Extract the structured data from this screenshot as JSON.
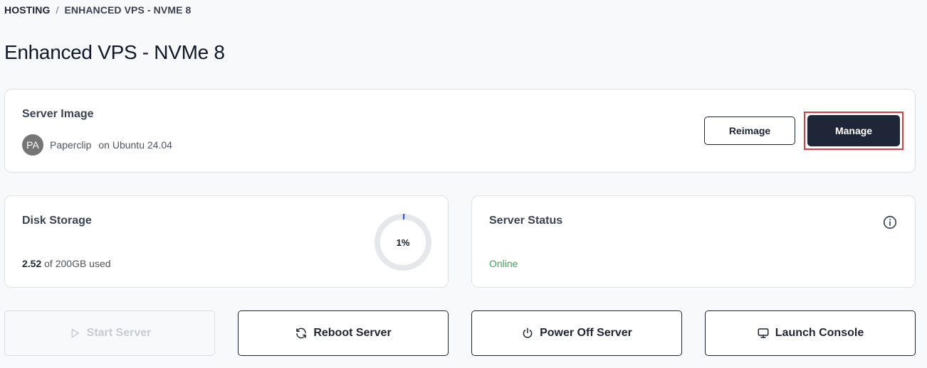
{
  "breadcrumb": {
    "root": "HOSTING",
    "separator": "/",
    "current": "ENHANCED VPS - NVME 8"
  },
  "page": {
    "title": "Enhanced VPS - NVMe 8"
  },
  "server_image": {
    "title": "Server Image",
    "avatar_initials": "PA",
    "app_name": "Paperclip",
    "os_text": "on Ubuntu 24.04",
    "reimage_label": "Reimage",
    "manage_label": "Manage",
    "icons": {
      "avatar": "avatar-circle"
    }
  },
  "disk": {
    "title": "Disk Storage",
    "used_amount": "2.52",
    "used_suffix": "of 200GB used",
    "percent_label": "1%",
    "percent_value": 1,
    "colors": {
      "ring_track": "#e5e7eb",
      "ring_fill": "#3b5bdb"
    }
  },
  "status": {
    "title": "Server Status",
    "value": "Online",
    "colors": {
      "online": "#3ea55a"
    },
    "icons": {
      "info": "info-icon"
    }
  },
  "actions": {
    "start": {
      "label": "Start Server",
      "icon": "play-icon",
      "disabled": true
    },
    "reboot": {
      "label": "Reboot Server",
      "icon": "refresh-icon"
    },
    "power_off": {
      "label": "Power Off Server",
      "icon": "power-icon"
    },
    "console": {
      "label": "Launch Console",
      "icon": "monitor-icon"
    }
  },
  "colors": {
    "primary_dark": "#1f2637",
    "highlight_outline": "#e03b3b",
    "background": "#f7f9fb"
  }
}
